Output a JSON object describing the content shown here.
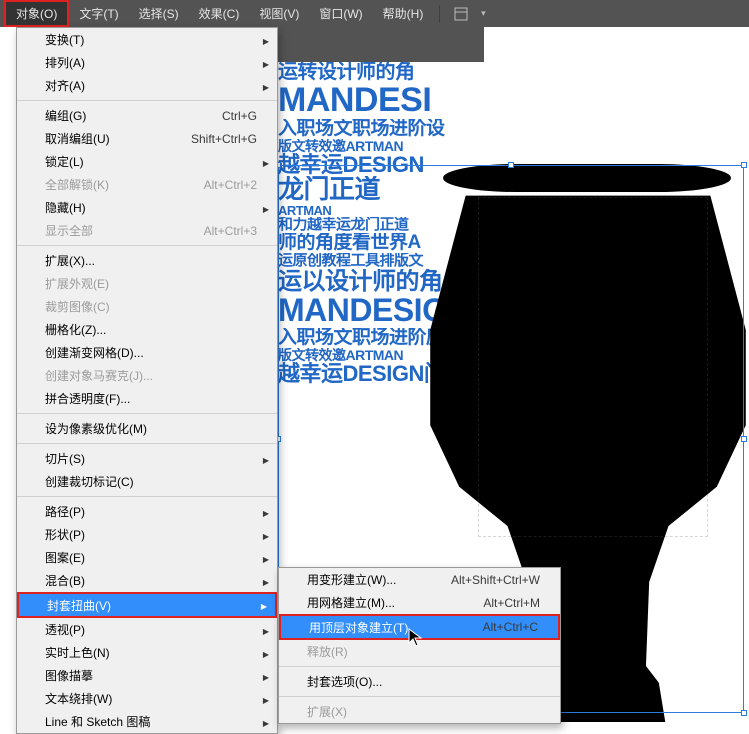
{
  "menubar": {
    "items": [
      {
        "label": "对象(O)",
        "active": true
      },
      {
        "label": "文字(T)"
      },
      {
        "label": "选择(S)"
      },
      {
        "label": "效果(C)"
      },
      {
        "label": "视图(V)"
      },
      {
        "label": "窗口(W)"
      },
      {
        "label": "帮助(H)"
      }
    ]
  },
  "dropdown": [
    {
      "label": "变换(T)",
      "sub": true
    },
    {
      "label": "排列(A)",
      "sub": true
    },
    {
      "label": "对齐(A)",
      "sub": true
    },
    {
      "sep": true
    },
    {
      "label": "编组(G)",
      "shortcut": "Ctrl+G"
    },
    {
      "label": "取消编组(U)",
      "shortcut": "Shift+Ctrl+G"
    },
    {
      "label": "锁定(L)",
      "sub": true
    },
    {
      "label": "全部解锁(K)",
      "shortcut": "Alt+Ctrl+2",
      "disabled": true
    },
    {
      "label": "隐藏(H)",
      "sub": true
    },
    {
      "label": "显示全部",
      "shortcut": "Alt+Ctrl+3",
      "disabled": true
    },
    {
      "sep": true
    },
    {
      "label": "扩展(X)..."
    },
    {
      "label": "扩展外观(E)",
      "disabled": true
    },
    {
      "label": "裁剪图像(C)",
      "disabled": true
    },
    {
      "label": "栅格化(Z)..."
    },
    {
      "label": "创建渐变网格(D)..."
    },
    {
      "label": "创建对象马赛克(J)...",
      "disabled": true
    },
    {
      "label": "拼合透明度(F)..."
    },
    {
      "sep": true
    },
    {
      "label": "设为像素级优化(M)"
    },
    {
      "sep": true
    },
    {
      "label": "切片(S)",
      "sub": true
    },
    {
      "label": "创建裁切标记(C)"
    },
    {
      "sep": true
    },
    {
      "label": "路径(P)",
      "sub": true
    },
    {
      "label": "形状(P)",
      "sub": true
    },
    {
      "label": "图案(E)",
      "sub": true
    },
    {
      "label": "混合(B)",
      "sub": true
    },
    {
      "label": "封套扭曲(V)",
      "sub": true,
      "hl": true
    },
    {
      "label": "透视(P)",
      "sub": true
    },
    {
      "label": "实时上色(N)",
      "sub": true
    },
    {
      "label": "图像描摹",
      "sub": true
    },
    {
      "label": "文本绕排(W)",
      "sub": true
    },
    {
      "label": "Line 和 Sketch 图稿",
      "sub": true
    }
  ],
  "submenu": [
    {
      "label": "用变形建立(W)...",
      "shortcut": "Alt+Shift+Ctrl+W"
    },
    {
      "label": "用网格建立(M)...",
      "shortcut": "Alt+Ctrl+M"
    },
    {
      "label": "用顶层对象建立(T)",
      "shortcut": "Alt+Ctrl+C",
      "hl": true
    },
    {
      "label": "释放(R)",
      "disabled": true
    },
    {
      "sep": true
    },
    {
      "label": "封套选项(O)..."
    },
    {
      "sep": true
    },
    {
      "label": "扩展(X)",
      "disabled": true
    }
  ],
  "canvas": {
    "words": [
      "运转设计师的角",
      "MANDESI",
      "入职场文职场进阶设",
      "版文转效邀ARTMAN",
      "越幸运DESIGN",
      "龙门正道",
      "ARTMAN",
      "和力越幸运龙门正道",
      "师的角度看世界A",
      "运原创教程工具排版文",
      "运以设计师的角",
      "MANDESIGN",
      "入职场文职场进阶庞",
      "版文转效邀ARTMAN",
      "越幸运DESIGN门"
    ]
  }
}
